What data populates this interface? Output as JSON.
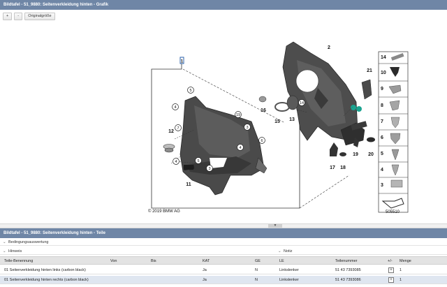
{
  "top_title": "Bildtafel - 51_9880: Seitenverkleidung hinten - Grafik",
  "toolbar": {
    "zoom_in": "+",
    "zoom_out": "-",
    "original_size": "Originalgröße"
  },
  "graphic": {
    "copyright": "© 2019 BMW AG",
    "image_number": "505510",
    "callouts": [
      "1",
      "2",
      "3",
      "4",
      "5",
      "6",
      "7",
      "8",
      "9",
      "10",
      "11",
      "12",
      "13",
      "14",
      "15",
      "16",
      "17",
      "18",
      "19",
      "20",
      "21"
    ],
    "sidebar_numbers": [
      "14",
      "10",
      "9",
      "8",
      "7",
      "6",
      "5",
      "4",
      "3"
    ]
  },
  "bottom_title": "Bildtafel - 51_9880: Seitenverkleidung hinten - Teile",
  "conditions_label": "Bedingungsauswertung",
  "hints_label": "Hinweis",
  "notes_label": "Notiz",
  "table": {
    "headers": [
      "Teile-Benennung",
      "Von",
      "Bis",
      "KAT",
      "GE",
      "LE",
      "Teilenummer",
      "+/-",
      "Menge"
    ],
    "rows": [
      {
        "name": "01 Seitenverkleidung hinten links (carbon black)",
        "von": "",
        "bis": "",
        "kat": "Ja",
        "ge": "N",
        "le": "Linkslenker",
        "partno": "51 43 7393085",
        "qty": "1"
      },
      {
        "name": "01 Seitenverkleidung hinten rechts (carbon black)",
        "von": "",
        "bis": "",
        "kat": "Ja",
        "ge": "N",
        "le": "Linkslenker",
        "partno": "51 43 7393086",
        "qty": "1"
      }
    ]
  }
}
